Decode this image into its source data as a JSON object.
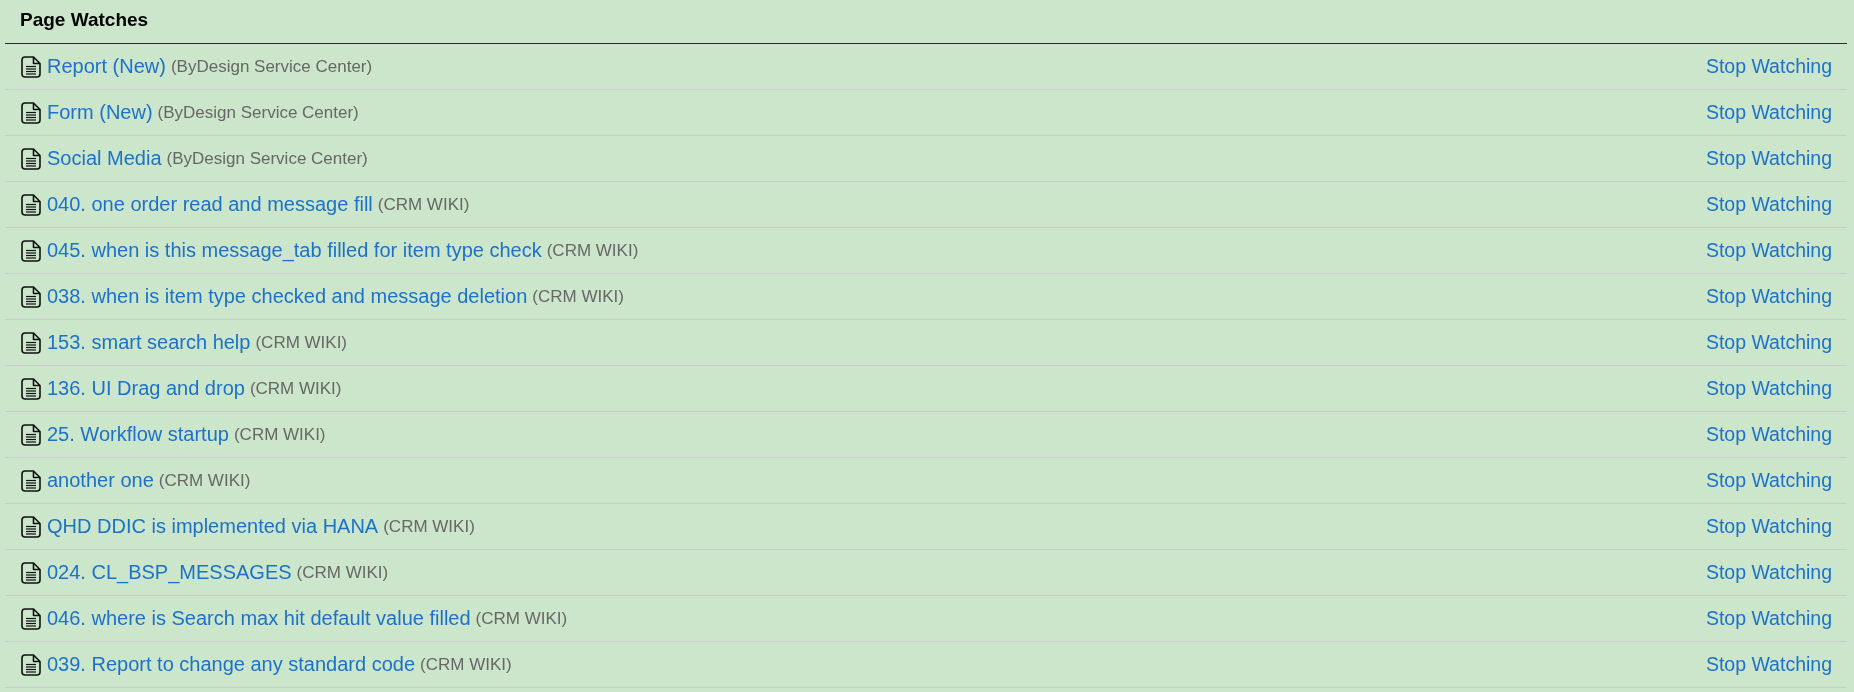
{
  "section": {
    "title": "Page Watches"
  },
  "watches": [
    {
      "title": "Report (New)",
      "space": "(ByDesign Service Center)",
      "action": "Stop Watching"
    },
    {
      "title": "Form (New)",
      "space": "(ByDesign Service Center)",
      "action": "Stop Watching"
    },
    {
      "title": "Social Media",
      "space": "(ByDesign Service Center)",
      "action": "Stop Watching"
    },
    {
      "title": "040. one order read and message fill",
      "space": "(CRM WIKI)",
      "action": "Stop Watching"
    },
    {
      "title": "045. when is this message_tab filled for item type check",
      "space": "(CRM WIKI)",
      "action": "Stop Watching"
    },
    {
      "title": "038. when is item type checked and message deletion",
      "space": "(CRM WIKI)",
      "action": "Stop Watching"
    },
    {
      "title": "153. smart search help",
      "space": "(CRM WIKI)",
      "action": "Stop Watching"
    },
    {
      "title": "136. UI Drag and drop",
      "space": "(CRM WIKI)",
      "action": "Stop Watching"
    },
    {
      "title": "25. Workflow startup",
      "space": "(CRM WIKI)",
      "action": "Stop Watching"
    },
    {
      "title": "another one",
      "space": "(CRM WIKI)",
      "action": "Stop Watching"
    },
    {
      "title": "QHD DDIC is implemented via HANA",
      "space": "(CRM WIKI)",
      "action": "Stop Watching"
    },
    {
      "title": "024. CL_BSP_MESSAGES",
      "space": "(CRM WIKI)",
      "action": "Stop Watching"
    },
    {
      "title": "046. where is Search max hit default value filled",
      "space": "(CRM WIKI)",
      "action": "Stop Watching"
    },
    {
      "title": "039. Report to change any standard code",
      "space": "(CRM WIKI)",
      "action": "Stop Watching"
    }
  ]
}
